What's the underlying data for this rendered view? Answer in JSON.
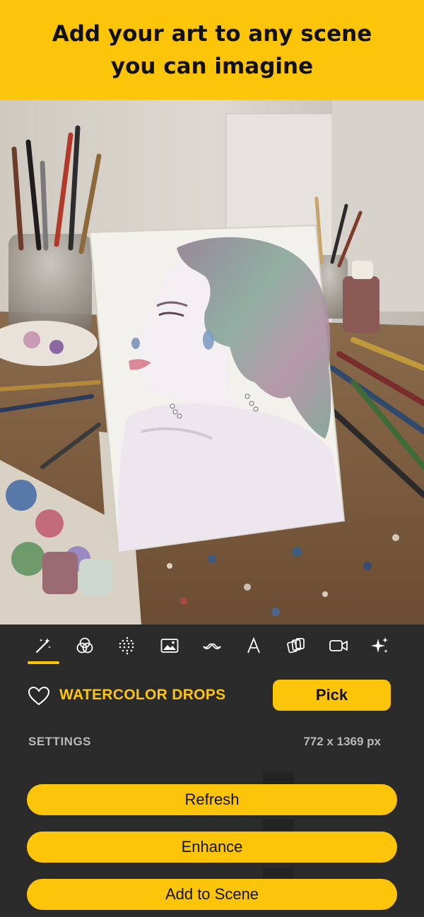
{
  "banner": {
    "line1": "Add your art to any scene",
    "line2": "you can imagine"
  },
  "toolbar": {
    "tools": [
      {
        "icon": "magic-wand-icon",
        "selected": true
      },
      {
        "icon": "color-circles-icon"
      },
      {
        "icon": "dot-grid-icon"
      },
      {
        "icon": "image-icon"
      },
      {
        "icon": "mustache-icon"
      },
      {
        "icon": "text-icon",
        "label": "A"
      },
      {
        "icon": "layers-icon"
      },
      {
        "icon": "video-icon"
      },
      {
        "icon": "sparkles-icon"
      }
    ]
  },
  "preset": {
    "name": "WATERCOLOR DROPS",
    "pick_label": "Pick"
  },
  "settings": {
    "label": "SETTINGS",
    "dimensions": "772 x 1369 px"
  },
  "actions": {
    "refresh": "Refresh",
    "enhance": "Enhance",
    "add_to_scene": "Add to Scene"
  },
  "colors": {
    "accent": "#fdc50a",
    "panel": "#2a2a2a"
  }
}
